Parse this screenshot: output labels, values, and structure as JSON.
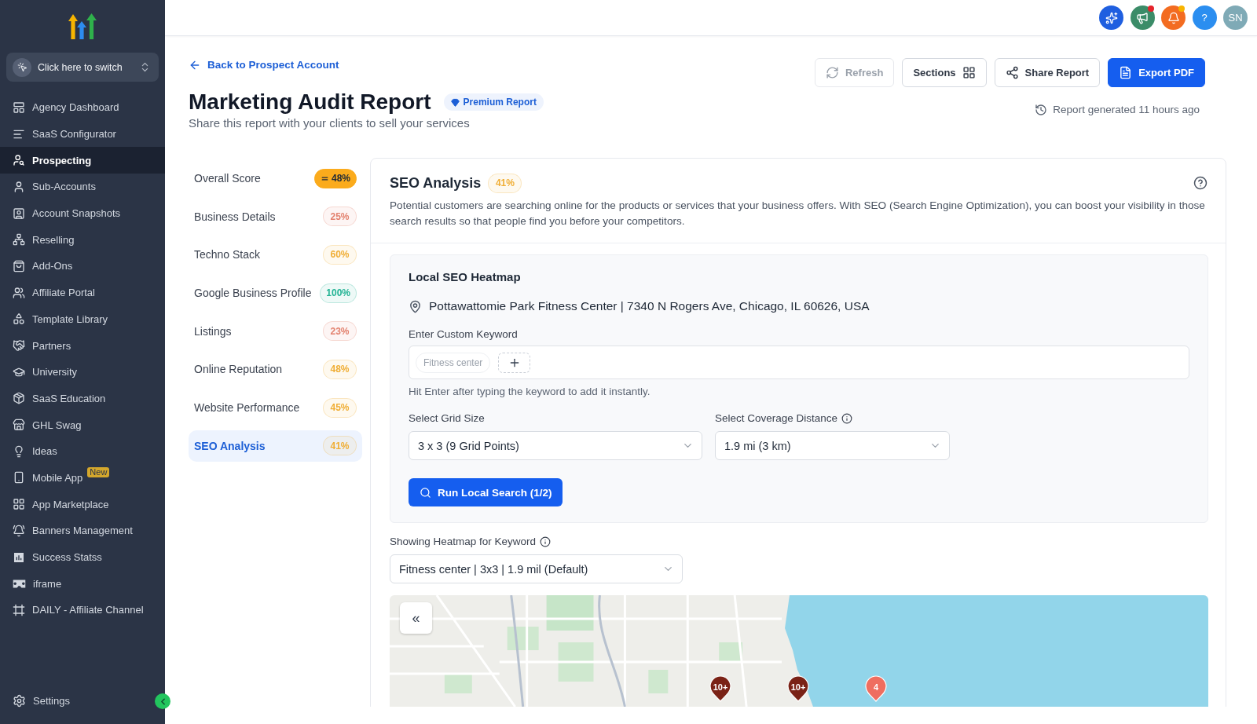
{
  "sidebar": {
    "switcher": {
      "label": "Click here to switch"
    },
    "items": [
      {
        "label": "Agency Dashboard",
        "selected": false
      },
      {
        "label": "SaaS Configurator",
        "selected": false
      },
      {
        "label": "Prospecting",
        "selected": true
      },
      {
        "label": "Sub-Accounts",
        "selected": false
      },
      {
        "label": "Account Snapshots",
        "selected": false
      },
      {
        "label": "Reselling",
        "selected": false
      },
      {
        "label": "Add-Ons",
        "selected": false
      },
      {
        "label": "Affiliate Portal",
        "selected": false
      },
      {
        "label": "Template Library",
        "selected": false
      },
      {
        "label": "Partners",
        "selected": false
      },
      {
        "label": "University",
        "selected": false
      },
      {
        "label": "SaaS Education",
        "selected": false
      },
      {
        "label": "GHL Swag",
        "selected": false
      },
      {
        "label": "Ideas",
        "selected": false
      },
      {
        "label": "Mobile App",
        "selected": false,
        "badge": "New"
      },
      {
        "label": "App Marketplace",
        "selected": false
      },
      {
        "label": "Banners Management",
        "selected": false
      },
      {
        "label": "Success Statss",
        "selected": false
      },
      {
        "label": "iframe",
        "selected": false
      },
      {
        "label": "DAILY - Affiliate Channel",
        "selected": false
      }
    ],
    "footer": {
      "label": "Settings"
    }
  },
  "topbar": {
    "buttons": [
      {
        "kind": "ai",
        "color": "#1f5fe0"
      },
      {
        "kind": "announcements",
        "color": "#3b8c68",
        "dot": {
          "color": "#e5242b"
        }
      },
      {
        "kind": "notifications",
        "color": "#f36c21",
        "dot": {
          "color": "#f8b400"
        }
      },
      {
        "kind": "help",
        "label": "?",
        "color": "#2b8ef0"
      },
      {
        "kind": "avatar",
        "label": "SN",
        "color": "#7faab6"
      }
    ]
  },
  "header": {
    "back_link": "Back to Prospect Account",
    "title": "Marketing Audit Report",
    "badge": "Premium Report",
    "subtitle": "Share this report with your clients to sell your services",
    "actions": [
      {
        "kind": "refresh",
        "label": "Refresh",
        "disabled": true
      },
      {
        "kind": "sections",
        "label": "Sections",
        "disabled": false
      },
      {
        "kind": "share",
        "label": "Share Report",
        "disabled": false
      },
      {
        "kind": "export",
        "label": "Export PDF",
        "disabled": false
      }
    ],
    "status": "Report generated 11 hours ago"
  },
  "sections": [
    {
      "kind": "overall",
      "label": "Overall Score",
      "score": "48%",
      "color": "#fbab1c",
      "selected": false
    },
    {
      "kind": "section",
      "label": "Business Details",
      "score": "25%",
      "color": "#e3826f",
      "selected": false
    },
    {
      "kind": "section",
      "label": "Techno Stack",
      "score": "60%",
      "color": "#f0ae35",
      "selected": false
    },
    {
      "kind": "section",
      "label": "Google Business Profile",
      "score": "100%",
      "color": "#22b394",
      "selected": false
    },
    {
      "kind": "section",
      "label": "Listings",
      "score": "23%",
      "color": "#e3826f",
      "selected": false
    },
    {
      "kind": "section",
      "label": "Online Reputation",
      "score": "48%",
      "color": "#f0ae35",
      "selected": false
    },
    {
      "kind": "section",
      "label": "Website Performance",
      "score": "45%",
      "color": "#f0ae35",
      "selected": false
    },
    {
      "kind": "section",
      "label": "SEO Analysis",
      "score": "41%",
      "color": "#f0ae35",
      "selected": true
    }
  ],
  "seo": {
    "title": "SEO Analysis",
    "score": {
      "label": "41%",
      "color": "#f0ae35"
    },
    "description": "Potential customers are searching online for the products or services that your business offers. With SEO (Search Engine Optimization), you can boost your visibility in those search results so that people find you before your competitors.",
    "heatmap": {
      "title": "Local SEO Heatmap",
      "location": "Pottawattomie Park Fitness Center | 7340 N Rogers Ave, Chicago, IL 60626, USA",
      "keyword_label": "Enter Custom Keyword",
      "keywords": [
        "Fitness center"
      ],
      "hint": "Hit Enter after typing the keyword to add it instantly.",
      "grid_size": {
        "label": "Select Grid Size",
        "value": "3 x 3 (9 Grid Points)"
      },
      "coverage": {
        "label": "Select Coverage Distance",
        "value": "1.9 mi (3 km)"
      },
      "run_button": "Run Local Search (1/2)"
    },
    "showing": {
      "label": "Showing Heatmap for Keyword",
      "value": "Fitness center | 3x3 | 1.9 mil (Default)"
    },
    "map": {
      "collapse_button": "«",
      "pins": [
        {
          "label": "10+",
          "color": "#7a2216"
        },
        {
          "label": "10+",
          "color": "#7a2216"
        },
        {
          "label": "4",
          "color": "#ef6e60"
        }
      ]
    }
  }
}
